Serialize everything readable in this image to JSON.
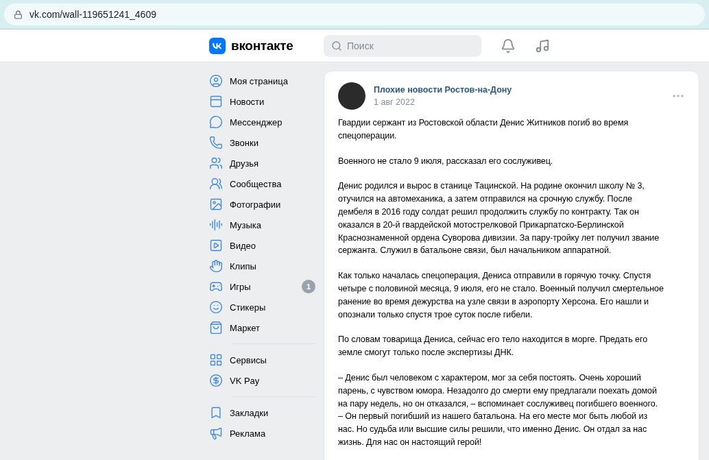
{
  "browser": {
    "url": "vk.com/wall-119651241_4609"
  },
  "header": {
    "logo_text": "вконтакте",
    "search": {
      "placeholder": "Поиск"
    }
  },
  "sidebar": {
    "groups": [
      {
        "items": [
          {
            "kind": "profile",
            "label": "Моя страница"
          },
          {
            "kind": "news",
            "label": "Новости"
          },
          {
            "kind": "messenger",
            "label": "Мессенджер"
          },
          {
            "kind": "calls",
            "label": "Звонки"
          },
          {
            "kind": "friends",
            "label": "Друзья"
          },
          {
            "kind": "communities",
            "label": "Сообщества"
          },
          {
            "kind": "photos",
            "label": "Фотографии"
          },
          {
            "kind": "music",
            "label": "Музыка"
          },
          {
            "kind": "video",
            "label": "Видео"
          },
          {
            "kind": "clips",
            "label": "Клипы"
          },
          {
            "kind": "games",
            "label": "Игры",
            "badge": "1"
          },
          {
            "kind": "stickers",
            "label": "Стикеры"
          },
          {
            "kind": "market",
            "label": "Маркет"
          }
        ]
      },
      {
        "items": [
          {
            "kind": "services",
            "label": "Сервисы"
          },
          {
            "kind": "pay",
            "label": "VK Pay"
          }
        ]
      },
      {
        "items": [
          {
            "kind": "bookmarks",
            "label": "Закладки"
          },
          {
            "kind": "ads",
            "label": "Реклама"
          }
        ]
      }
    ]
  },
  "post": {
    "author": "Плохие новости Ростов-на-Дону",
    "date": "1 авг 2022",
    "paragraphs": [
      "Гвардии сержант из Ростовской области Денис Житников погиб во время спецоперации.",
      "Военного не стало 9 июля, рассказал его сослуживец.",
      "Денис родился и вырос в станице Тацинской. На родине окончил школу № 3, отучился на автомеханика, а затем отправился на срочную службу. После дембеля в 2016 году солдат решил продолжить службу по контракту. Так он оказался в 20-й гвардейской мотострелковой Прикарпатско-Берлинской Краснознаменной ордена Суворова дивизии. За пару-тройку лет получил звание сержанта. Служил в батальоне связи, был начальником аппаратной.",
      "Как только началась спецоперация, Дениса отправили в горячую точку. Спустя четыре с половиной месяца, 9 июля, его не стало. Военный получил смертельное ранение во время дежурства на узле связи в аэропорту Херсона. Его нашли и опознали только спустя трое суток после гибели.",
      "По словам товарища Дениса, сейчас его тело находится в морге. Предать его земле смогут только после экспертизы ДНК.",
      "– Денис был человеком с характером, мог за себя постоять. Очень хороший парень, с чувством юмора. Незадолго до смерти ему предлагали поехать домой на пару недель, но он отказался, – вспоминает сослуживец погибшего военного. – Он первый погибший из нашего батальона. На его месте мог быть любой из нас. Но судьба или высшие силы решили, что именно Денис. Он отдал за нас жизнь. Для нас он настоящий герой!"
    ]
  }
}
